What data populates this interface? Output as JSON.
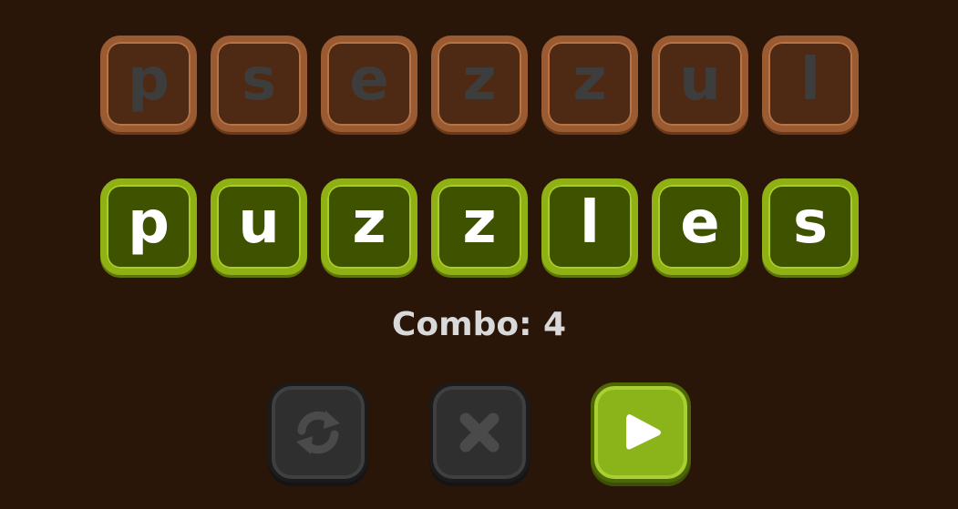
{
  "scrambled_tiles": [
    "p",
    "s",
    "e",
    "z",
    "z",
    "u",
    "l"
  ],
  "answer_tiles": [
    "p",
    "u",
    "z",
    "z",
    "l",
    "e",
    "s"
  ],
  "combo_text": "Combo: 4",
  "buttons": {
    "refresh": "refresh-icon",
    "clear": "close-icon",
    "play": "play-icon"
  },
  "colors": {
    "background": "#2a1608",
    "scrambled_tile": "#4e2a14",
    "answer_tile": "#3f5200",
    "accent_green": "#8bb31a"
  }
}
